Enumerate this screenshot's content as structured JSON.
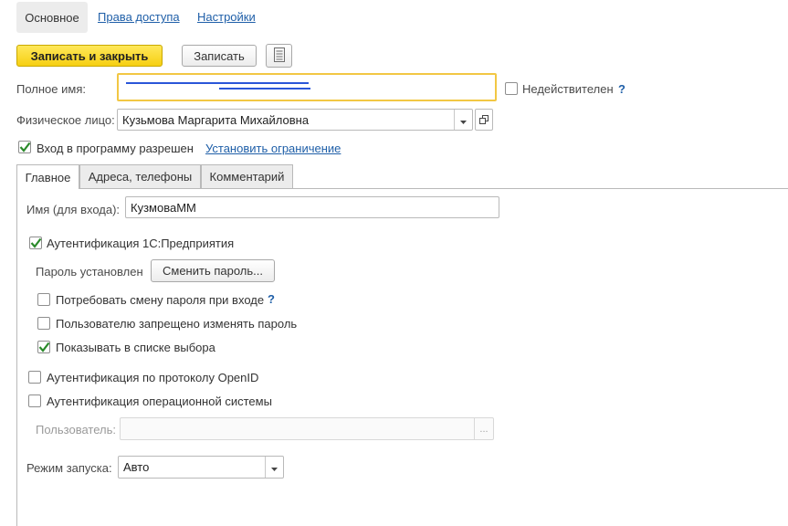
{
  "nav": {
    "main": "Основное",
    "access_rights": "Права доступа",
    "settings": "Настройки"
  },
  "toolbar": {
    "save_close": "Записать и закрыть",
    "save": "Записать"
  },
  "form": {
    "full_name_label": "Полное имя:",
    "full_name_value": "",
    "invalid_label": "Недействителен",
    "help": "?",
    "person_label": "Физическое лицо:",
    "person_value": "Кузьмова Маргарита Михайловна",
    "login_allowed_label": "Вход в программу разрешен",
    "set_restriction_link": "Установить ограничение"
  },
  "tabs": {
    "main": "Главное",
    "addresses": "Адреса, телефоны",
    "comment": "Комментарий"
  },
  "main_tab": {
    "login_name_label": "Имя (для входа):",
    "login_name_value": "КузмоваММ",
    "auth_1c_label": "Аутентификация 1С:Предприятия",
    "password_set_label": "Пароль установлен",
    "change_password_button": "Сменить пароль...",
    "require_change_label": "Потребовать смену пароля при входе",
    "forbid_change_label": "Пользователю запрещено изменять пароль",
    "show_in_list_label": "Показывать в списке выбора",
    "openid_label": "Аутентификация по протоколу OpenID",
    "os_auth_label": "Аутентификация операционной системы",
    "user_label": "Пользователь:",
    "user_value": "",
    "user_select_button": "...",
    "launch_mode_label": "Режим запуска:",
    "launch_mode_value": "Авто"
  },
  "state": {
    "invalid_checked": false,
    "login_allowed_checked": true,
    "auth_1c_checked": true,
    "require_change_checked": false,
    "forbid_change_checked": false,
    "show_in_list_checked": true,
    "openid_checked": false,
    "os_auth_checked": false
  },
  "colors": {
    "accent_link": "#1f5fa8",
    "primary_button": "#f6cf12",
    "focus_border": "#f2c744",
    "check_mark": "#2a8a2a"
  },
  "icons": {
    "form_icon": "document-list-icon",
    "dropdown": "triangle-down-icon",
    "open": "open-window-icon",
    "check": "checkmark-icon"
  }
}
